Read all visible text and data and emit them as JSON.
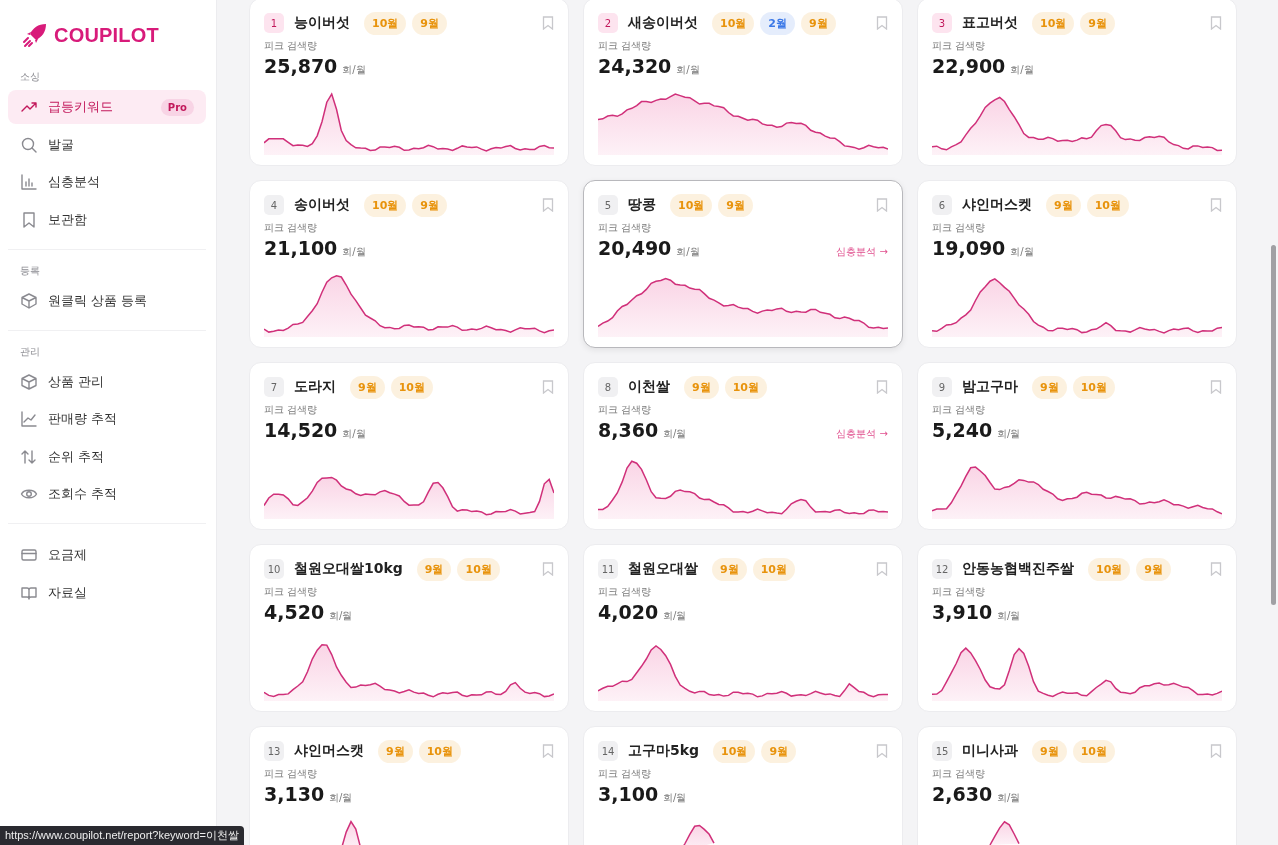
{
  "sidebar": {
    "logo": "COUPILOT",
    "sections": [
      {
        "label": "소싱",
        "items": [
          {
            "label": "급등키워드",
            "kind": "trend",
            "selected": true,
            "badge": "Pro"
          },
          {
            "label": "발굴",
            "kind": "search",
            "selected": false
          },
          {
            "label": "심층분석",
            "kind": "bars",
            "selected": false
          },
          {
            "label": "보관함",
            "kind": "bookmark",
            "selected": false
          }
        ]
      },
      {
        "label": "등록",
        "items": [
          {
            "label": "원클릭 상품 등록",
            "kind": "boxplus",
            "selected": false
          }
        ]
      },
      {
        "label": "관리",
        "items": [
          {
            "label": "상품 관리",
            "kind": "box",
            "selected": false
          },
          {
            "label": "판매량 추적",
            "kind": "linechart",
            "selected": false
          },
          {
            "label": "순위 추적",
            "kind": "updown",
            "selected": false
          },
          {
            "label": "조회수 추적",
            "kind": "eye",
            "selected": false
          }
        ]
      },
      {
        "items": [
          {
            "label": "요금제",
            "kind": "card",
            "selected": false
          },
          {
            "label": "자료실",
            "kind": "book",
            "selected": false
          }
        ]
      }
    ]
  },
  "cards": [
    {
      "rank": "1",
      "top": true,
      "name": "능이버섯",
      "tags": [
        {
          "label": "10월",
          "color": "#e8930c"
        },
        {
          "label": "9월",
          "color": "#e8930c"
        }
      ],
      "peak_label": "피크 검색량",
      "value": "25,870",
      "unit": "회/월",
      "hovered": false
    },
    {
      "rank": "2",
      "top": true,
      "name": "새송이버섯",
      "tags": [
        {
          "label": "10월",
          "color": "#e8930c"
        },
        {
          "label": "2월",
          "color": "#3b78e7"
        },
        {
          "label": "9월",
          "color": "#e8930c"
        }
      ],
      "peak_label": "피크 검색량",
      "value": "24,320",
      "unit": "회/월",
      "hovered": false
    },
    {
      "rank": "3",
      "top": true,
      "name": "표고버섯",
      "tags": [
        {
          "label": "10월",
          "color": "#e8930c"
        },
        {
          "label": "9월",
          "color": "#e8930c"
        }
      ],
      "peak_label": "피크 검색량",
      "value": "22,900",
      "unit": "회/월",
      "hovered": false
    },
    {
      "rank": "4",
      "top": false,
      "name": "송이버섯",
      "tags": [
        {
          "label": "10월",
          "color": "#e8930c"
        },
        {
          "label": "9월",
          "color": "#e8930c"
        }
      ],
      "peak_label": "피크 검색량",
      "value": "21,100",
      "unit": "회/월",
      "hovered": false
    },
    {
      "rank": "5",
      "top": false,
      "name": "땅콩",
      "tags": [
        {
          "label": "10월",
          "color": "#e8930c"
        },
        {
          "label": "9월",
          "color": "#e8930c"
        }
      ],
      "peak_label": "피크 검색량",
      "value": "20,490",
      "unit": "회/월",
      "link": "심층분석 →",
      "hovered": true
    },
    {
      "rank": "6",
      "top": false,
      "name": "샤인머스켓",
      "tags": [
        {
          "label": "9월",
          "color": "#e8930c"
        },
        {
          "label": "10월",
          "color": "#e8930c"
        }
      ],
      "peak_label": "피크 검색량",
      "value": "19,090",
      "unit": "회/월",
      "hovered": false
    },
    {
      "rank": "7",
      "top": false,
      "name": "도라지",
      "tags": [
        {
          "label": "9월",
          "color": "#e8930c"
        },
        {
          "label": "10월",
          "color": "#e8930c"
        }
      ],
      "peak_label": "피크 검색량",
      "value": "14,520",
      "unit": "회/월",
      "hovered": false
    },
    {
      "rank": "8",
      "top": false,
      "name": "이천쌀",
      "tags": [
        {
          "label": "9월",
          "color": "#e8930c"
        },
        {
          "label": "10월",
          "color": "#e8930c"
        }
      ],
      "peak_label": "피크 검색량",
      "value": "8,360",
      "unit": "회/월",
      "link": "심층분석 →",
      "hovered": false
    },
    {
      "rank": "9",
      "top": false,
      "name": "밤고구마",
      "tags": [
        {
          "label": "9월",
          "color": "#e8930c"
        },
        {
          "label": "10월",
          "color": "#e8930c"
        }
      ],
      "peak_label": "피크 검색량",
      "value": "5,240",
      "unit": "회/월",
      "hovered": false
    },
    {
      "rank": "10",
      "top": false,
      "name": "철원오대쌀10kg",
      "tags": [
        {
          "label": "9월",
          "color": "#e8930c"
        },
        {
          "label": "10월",
          "color": "#e8930c"
        }
      ],
      "peak_label": "피크 검색량",
      "value": "4,520",
      "unit": "회/월",
      "hovered": false
    },
    {
      "rank": "11",
      "top": false,
      "name": "철원오대쌀",
      "tags": [
        {
          "label": "9월",
          "color": "#e8930c"
        },
        {
          "label": "10월",
          "color": "#e8930c"
        }
      ],
      "peak_label": "피크 검색량",
      "value": "4,020",
      "unit": "회/월",
      "hovered": false
    },
    {
      "rank": "12",
      "top": false,
      "name": "안동농협백진주쌀",
      "tags": [
        {
          "label": "10월",
          "color": "#e8930c"
        },
        {
          "label": "9월",
          "color": "#e8930c"
        }
      ],
      "peak_label": "피크 검색량",
      "value": "3,910",
      "unit": "회/월",
      "hovered": false
    },
    {
      "rank": "13",
      "top": false,
      "name": "샤인머스캣",
      "tags": [
        {
          "label": "9월",
          "color": "#e8930c"
        },
        {
          "label": "10월",
          "color": "#e8930c"
        }
      ],
      "peak_label": "피크 검색량",
      "value": "3,130",
      "unit": "회/월",
      "hovered": false
    },
    {
      "rank": "14",
      "top": false,
      "name": "고구마5kg",
      "tags": [
        {
          "label": "10월",
          "color": "#e8930c"
        },
        {
          "label": "9월",
          "color": "#e8930c"
        }
      ],
      "peak_label": "피크 검색량",
      "value": "3,100",
      "unit": "회/월",
      "hovered": false
    },
    {
      "rank": "15",
      "top": false,
      "name": "미니사과",
      "tags": [
        {
          "label": "9월",
          "color": "#e8930c"
        },
        {
          "label": "10월",
          "color": "#e8930c"
        }
      ],
      "peak_label": "피크 검색량",
      "value": "2,630",
      "unit": "회/월",
      "hovered": false
    }
  ],
  "status_url": "https://www.coupilot.net/report?keyword=이천쌀"
}
